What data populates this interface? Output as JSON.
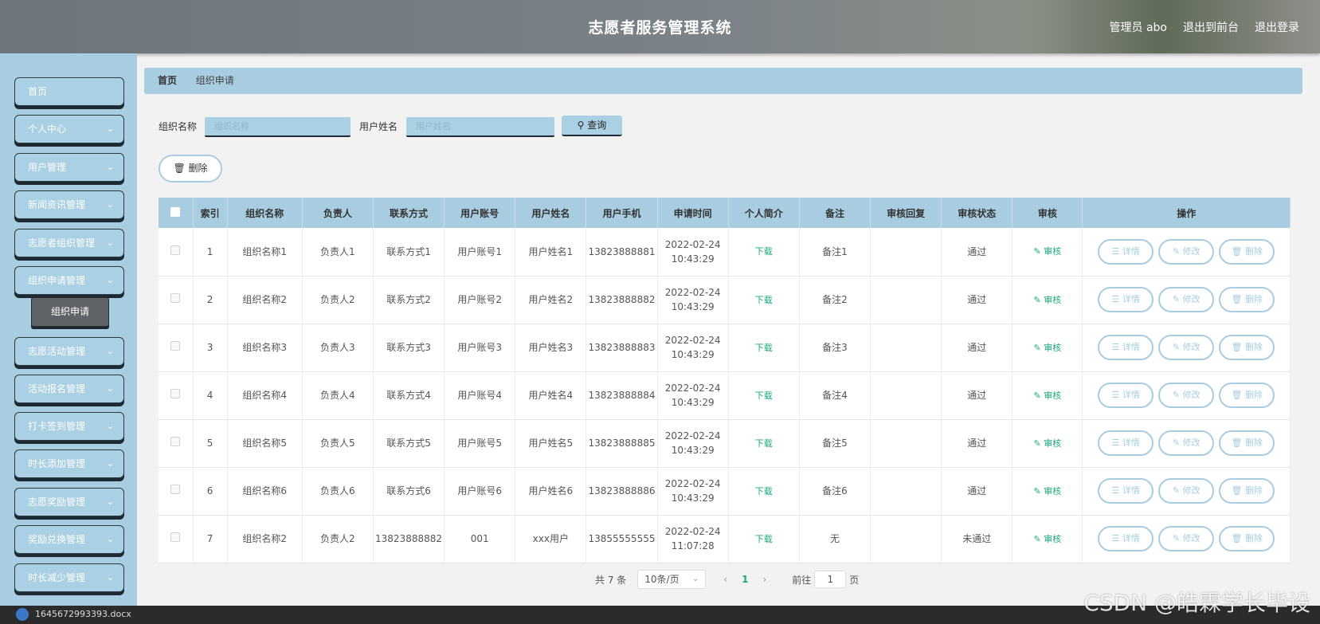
{
  "header": {
    "title": "志愿者服务管理系统",
    "admin_label": "管理员 abo",
    "exit_front": "退出到前台",
    "logout": "退出登录"
  },
  "sidebar": {
    "items": [
      {
        "label": "首页",
        "has_arrow": false
      },
      {
        "label": "个人中心",
        "has_arrow": true
      },
      {
        "label": "用户管理",
        "has_arrow": true
      },
      {
        "label": "新闻资讯管理",
        "has_arrow": true
      },
      {
        "label": "志愿者组织管理",
        "has_arrow": true
      },
      {
        "label": "组织申请管理",
        "has_arrow": true
      },
      {
        "label": "志愿活动管理",
        "has_arrow": true
      },
      {
        "label": "活动报名管理",
        "has_arrow": true
      },
      {
        "label": "打卡签到管理",
        "has_arrow": true
      },
      {
        "label": "时长添加管理",
        "has_arrow": true
      },
      {
        "label": "志愿奖励管理",
        "has_arrow": true
      },
      {
        "label": "奖励兑换管理",
        "has_arrow": true
      },
      {
        "label": "时长减少管理",
        "has_arrow": true
      }
    ],
    "active_sub": "组织申请"
  },
  "breadcrumb": {
    "home": "首页",
    "current": "组织申请"
  },
  "search": {
    "org_label": "组织名称",
    "org_placeholder": "组织名称",
    "user_label": "用户姓名",
    "user_placeholder": "用户姓名",
    "query_label": "查询"
  },
  "actions": {
    "delete_label": "删除"
  },
  "table": {
    "headers": [
      "索引",
      "组织名称",
      "负责人",
      "联系方式",
      "用户账号",
      "用户姓名",
      "用户手机",
      "申请时间",
      "个人简介",
      "备注",
      "审核回复",
      "审核状态",
      "审核",
      "操作"
    ],
    "download_label": "下载",
    "audit_label": "审核",
    "op_detail": "详情",
    "op_edit": "修改",
    "op_delete": "删除",
    "rows": [
      [
        "1",
        "组织名称1",
        "负责人1",
        "联系方式1",
        "用户账号1",
        "用户姓名1",
        "13823888881",
        "2022-02-24 10:43:29",
        "备注1",
        "",
        "通过"
      ],
      [
        "2",
        "组织名称2",
        "负责人2",
        "联系方式2",
        "用户账号2",
        "用户姓名2",
        "13823888882",
        "2022-02-24 10:43:29",
        "备注2",
        "",
        "通过"
      ],
      [
        "3",
        "组织名称3",
        "负责人3",
        "联系方式3",
        "用户账号3",
        "用户姓名3",
        "13823888883",
        "2022-02-24 10:43:29",
        "备注3",
        "",
        "通过"
      ],
      [
        "4",
        "组织名称4",
        "负责人4",
        "联系方式4",
        "用户账号4",
        "用户姓名4",
        "13823888884",
        "2022-02-24 10:43:29",
        "备注4",
        "",
        "通过"
      ],
      [
        "5",
        "组织名称5",
        "负责人5",
        "联系方式5",
        "用户账号5",
        "用户姓名5",
        "13823888885",
        "2022-02-24 10:43:29",
        "备注5",
        "",
        "通过"
      ],
      [
        "6",
        "组织名称6",
        "负责人6",
        "联系方式6",
        "用户账号6",
        "用户姓名6",
        "13823888886",
        "2022-02-24 10:43:29",
        "备注6",
        "",
        "通过"
      ],
      [
        "7",
        "组织名称2",
        "负责人2",
        "13823888882",
        "001",
        "xxx用户",
        "13855555555",
        "2022-02-24 11:07:28",
        "无",
        "",
        "未通过"
      ]
    ]
  },
  "pager": {
    "total": "共 7 条",
    "page_size": "10条/页",
    "current_page": "1",
    "goto_label": "前往",
    "goto_value": "1",
    "page_suffix": "页"
  },
  "taskbar": {
    "filename": "1645672993393.docx"
  },
  "watermark": "CSDN @皓霖学长毕设",
  "colors": {
    "accent": "#a8cde0",
    "link": "#1aa97b",
    "header": "#7b8288"
  }
}
